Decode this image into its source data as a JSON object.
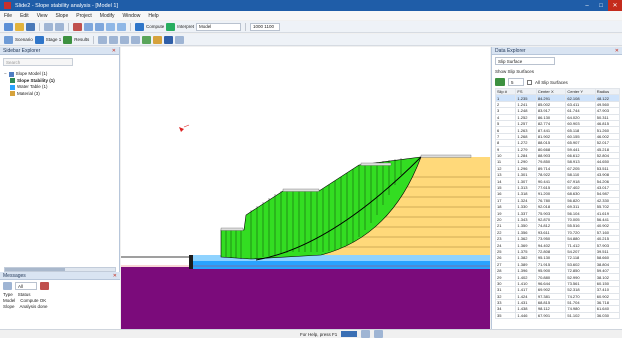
{
  "window": {
    "title": "Slide2 - Slope stability analysis - [Model 1]"
  },
  "menu": [
    "File",
    "Edit",
    "View",
    "Slope",
    "Project",
    "Modify",
    "Window",
    "Help"
  ],
  "toolbar": {
    "compute_label": "Compute",
    "scenario_label": "Scenario",
    "stage_label": "Stage 1",
    "results_label": "Results",
    "interpret_label": "Interpret",
    "model_dropdown": "Model",
    "view_dropdown": "1000 1100"
  },
  "sidebar": {
    "title": "Sidebar Explorer",
    "search_placeholder": "Search",
    "tree": [
      {
        "label": "Slope Model (1)",
        "level": 0
      },
      {
        "label": "Slope Stability (1)",
        "level": 1,
        "bold": true
      },
      {
        "label": "Water Table (1)",
        "level": 1
      },
      {
        "label": "Material (3)",
        "level": 1
      }
    ]
  },
  "messages": {
    "title": "Messages",
    "filter_label": "All",
    "columns": [
      "Type",
      "Status"
    ],
    "rows": [
      [
        "Model",
        "Compute OK"
      ],
      [
        "Slope",
        "Analysis done"
      ]
    ]
  },
  "rightpanel": {
    "title": "Data Explorer",
    "dropdown": "Slip Surface",
    "filter_label": "Show Slip Surfaces",
    "count_value": "5",
    "checkbox_label": "All Slip Surfaces",
    "columns": [
      "Slip #",
      "FS",
      "Center X",
      "Center Y",
      "Radius"
    ],
    "rows": [
      [
        "1",
        "1.235",
        "84.291",
        "62.108",
        "48.122"
      ],
      [
        "2",
        "1.241",
        "85.002",
        "63.411",
        "49.560"
      ],
      [
        "3",
        "1.248",
        "83.917",
        "61.744",
        "47.903"
      ],
      [
        "4",
        "1.252",
        "86.130",
        "64.020",
        "50.311"
      ],
      [
        "5",
        "1.257",
        "82.774",
        "60.903",
        "46.815"
      ],
      [
        "6",
        "1.263",
        "87.441",
        "65.118",
        "51.260"
      ],
      [
        "7",
        "1.268",
        "81.902",
        "60.155",
        "46.002"
      ],
      [
        "8",
        "1.272",
        "88.015",
        "65.907",
        "52.017"
      ],
      [
        "9",
        "1.279",
        "80.668",
        "59.441",
        "45.218"
      ],
      [
        "10",
        "1.284",
        "88.903",
        "66.612",
        "52.804"
      ],
      [
        "11",
        "1.290",
        "79.850",
        "58.913",
        "44.650"
      ],
      [
        "12",
        "1.296",
        "89.714",
        "67.205",
        "53.511"
      ],
      [
        "13",
        "1.301",
        "78.922",
        "58.110",
        "43.908"
      ],
      [
        "14",
        "1.307",
        "90.441",
        "67.918",
        "54.206"
      ],
      [
        "15",
        "1.313",
        "77.615",
        "57.402",
        "43.017"
      ],
      [
        "16",
        "1.318",
        "91.200",
        "68.630",
        "54.987"
      ],
      [
        "17",
        "1.324",
        "76.780",
        "56.820",
        "42.330"
      ],
      [
        "18",
        "1.330",
        "92.018",
        "69.311",
        "55.702"
      ],
      [
        "19",
        "1.337",
        "75.903",
        "56.104",
        "41.619"
      ],
      [
        "20",
        "1.343",
        "92.870",
        "70.005",
        "56.441"
      ],
      [
        "21",
        "1.350",
        "74.812",
        "55.516",
        "40.902"
      ],
      [
        "22",
        "1.356",
        "93.611",
        "70.720",
        "57.160"
      ],
      [
        "23",
        "1.362",
        "73.950",
        "54.880",
        "40.215"
      ],
      [
        "24",
        "1.369",
        "94.402",
        "71.412",
        "57.903"
      ],
      [
        "25",
        "1.375",
        "72.808",
        "54.207",
        "39.511"
      ],
      [
        "26",
        "1.382",
        "95.130",
        "72.118",
        "58.660"
      ],
      [
        "27",
        "1.389",
        "71.915",
        "53.602",
        "38.804"
      ],
      [
        "28",
        "1.396",
        "95.900",
        "72.850",
        "59.407"
      ],
      [
        "29",
        "1.402",
        "70.880",
        "52.990",
        "38.102"
      ],
      [
        "30",
        "1.410",
        "96.644",
        "73.561",
        "60.150"
      ],
      [
        "31",
        "1.417",
        "69.902",
        "52.318",
        "37.410"
      ],
      [
        "32",
        "1.424",
        "97.381",
        "74.270",
        "60.902"
      ],
      [
        "33",
        "1.431",
        "68.815",
        "51.704",
        "36.718"
      ],
      [
        "34",
        "1.438",
        "98.112",
        "74.980",
        "61.640"
      ],
      [
        "35",
        "1.446",
        "67.901",
        "51.102",
        "36.030"
      ]
    ]
  },
  "status": {
    "text": "For Help, press F1"
  },
  "colors": {
    "fill_green": "#33dd22",
    "layer_orange": "#ffd97a",
    "layer_blue": "#29a3ff",
    "layer_light_blue": "#8fd3ff",
    "bedrock_purple": "#7b0b7b",
    "accent": "#1f5da8"
  }
}
